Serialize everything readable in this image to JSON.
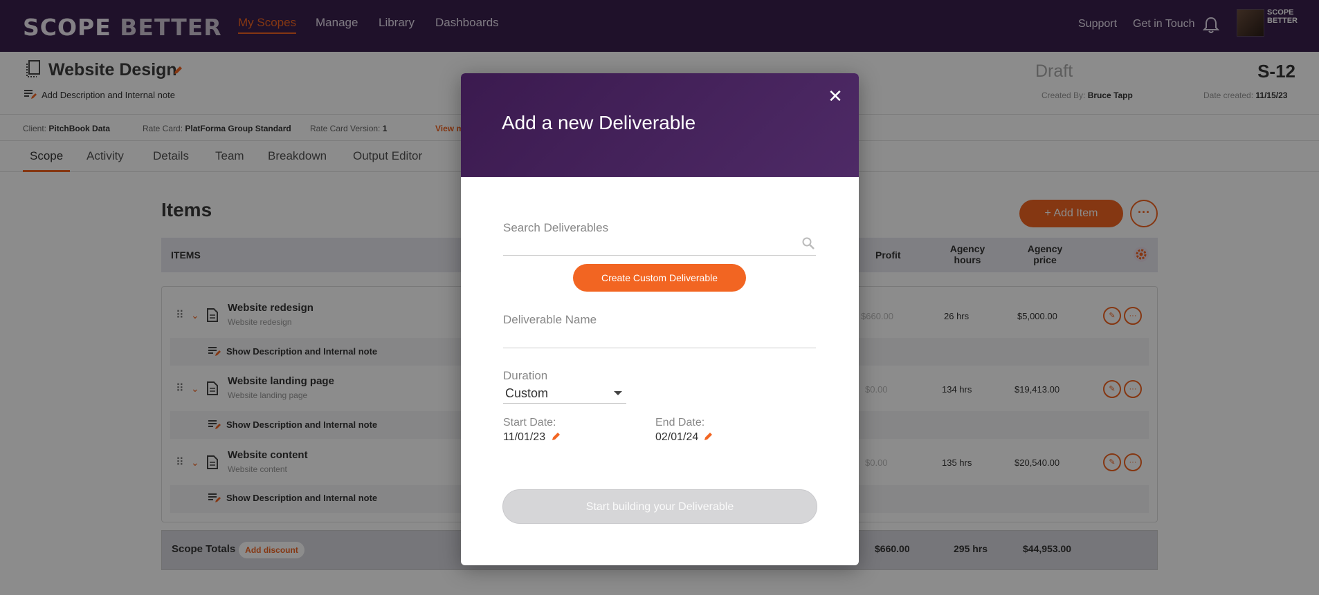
{
  "brand": {
    "logo_left": "SCOPE",
    "logo_right": "BETTER",
    "accent": "#f26522",
    "navbar_bg": "#3a1f4d"
  },
  "nav": {
    "links": [
      "My Scopes",
      "Manage",
      "Library",
      "Dashboards"
    ],
    "active": "My Scopes",
    "support": "Support",
    "get_in_touch": "Get in Touch",
    "avatar_badge": "SCOPE BETTER"
  },
  "scope": {
    "title": "Website Design",
    "add_description": "Add Description and Internal note",
    "status": "Draft",
    "id": "S-12",
    "created_by_label": "Created By:",
    "created_by": "Bruce Tapp",
    "date_created_label": "Date created:",
    "date_created": "11/15/23",
    "client_label": "Client:",
    "client": "PitchBook Data",
    "rate_card_label": "Rate Card:",
    "rate_card": "PlatForma Group Standard",
    "rate_card_version_label": "Rate Card Version:",
    "rate_card_version": "1",
    "view_more": "View m"
  },
  "tabs": [
    "Scope",
    "Activity",
    "Details",
    "Team",
    "Breakdown",
    "Output Editor"
  ],
  "items": {
    "title": "Items",
    "add_item": "+ Add Item",
    "columns": {
      "items": "ITEMS",
      "profit": "Profit",
      "agency_hours": "Agency hours",
      "agency_price": "Agency price"
    },
    "show_description": "Show Description and Internal note",
    "rows": [
      {
        "name": "Website redesign",
        "sub": "Website redesign",
        "profit": "$660.00",
        "hours": "26 hrs",
        "price": "$5,000.00"
      },
      {
        "name": "Website landing page",
        "sub": "Website landing page",
        "profit": "$0.00",
        "hours": "134 hrs",
        "price": "$19,413.00"
      },
      {
        "name": "Website content",
        "sub": "Website content",
        "profit": "$0.00",
        "hours": "135 hrs",
        "price": "$20,540.00"
      }
    ],
    "totals": {
      "label": "Scope Totals",
      "discount": "Add discount",
      "profit": "$660.00",
      "hours": "295 hrs",
      "price": "$44,953.00"
    }
  },
  "modal": {
    "title": "Add a new Deliverable",
    "search_label": "Search Deliverables",
    "search_value": "",
    "custom_button": "Create Custom Deliverable",
    "name_label": "Deliverable Name",
    "name_value": "",
    "duration_label": "Duration",
    "duration_value": "Custom",
    "start_label": "Start Date:",
    "start_value": "11/01/23",
    "end_label": "End Date:",
    "end_value": "02/01/24",
    "submit": "Start building your Deliverable"
  }
}
